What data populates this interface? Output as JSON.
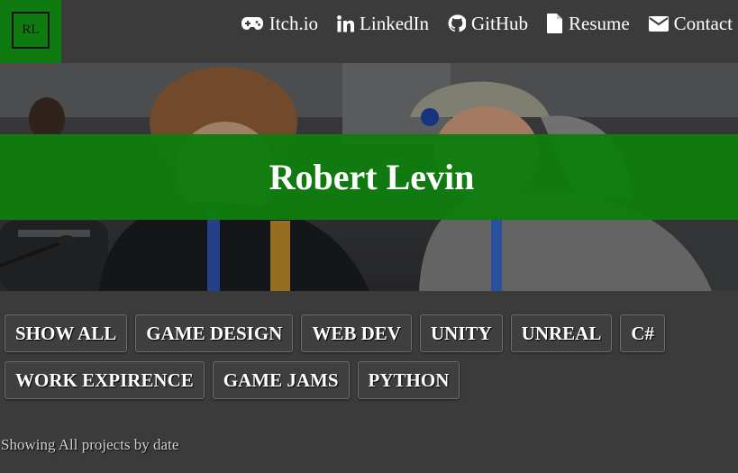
{
  "logo": {
    "initials": "RL"
  },
  "nav": {
    "items": [
      {
        "label": "Itch.io",
        "icon": "gamepad-icon"
      },
      {
        "label": "LinkedIn",
        "icon": "linkedin-icon"
      },
      {
        "label": "GitHub",
        "icon": "github-icon"
      },
      {
        "label": "Resume",
        "icon": "document-icon"
      },
      {
        "label": "Contact",
        "icon": "envelope-icon"
      }
    ]
  },
  "hero": {
    "title": "Robert Levin",
    "banner_color": "#107d10"
  },
  "filters": {
    "row1": [
      "SHOW ALL",
      "GAME DESIGN",
      "WEB DEV",
      "UNITY",
      "UNREAL",
      "C#"
    ],
    "row2": [
      "WORK EXPIRENCE",
      "GAME JAMS",
      "PYTHON"
    ]
  },
  "status": {
    "text": "Showing All projects by date"
  },
  "colors": {
    "accent_green": "#0f7a0f",
    "background": "#3b3b3b"
  }
}
